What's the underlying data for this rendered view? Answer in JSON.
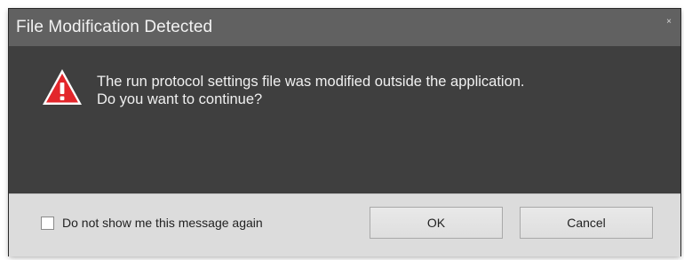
{
  "dialog": {
    "title": "File Modification Detected",
    "close_glyph": "×",
    "icon": "warning-icon",
    "message_line1": "The run protocol settings file was modified outside the application.",
    "message_line2": "Do you want to continue?",
    "checkbox_label": "Do not show me this message again",
    "checkbox_checked": false,
    "ok_label": "OK",
    "cancel_label": "Cancel",
    "colors": {
      "titlebar": "#616161",
      "body": "#3f3f3f",
      "footer": "#dcdcdc",
      "warning_red": "#e3262b"
    }
  }
}
